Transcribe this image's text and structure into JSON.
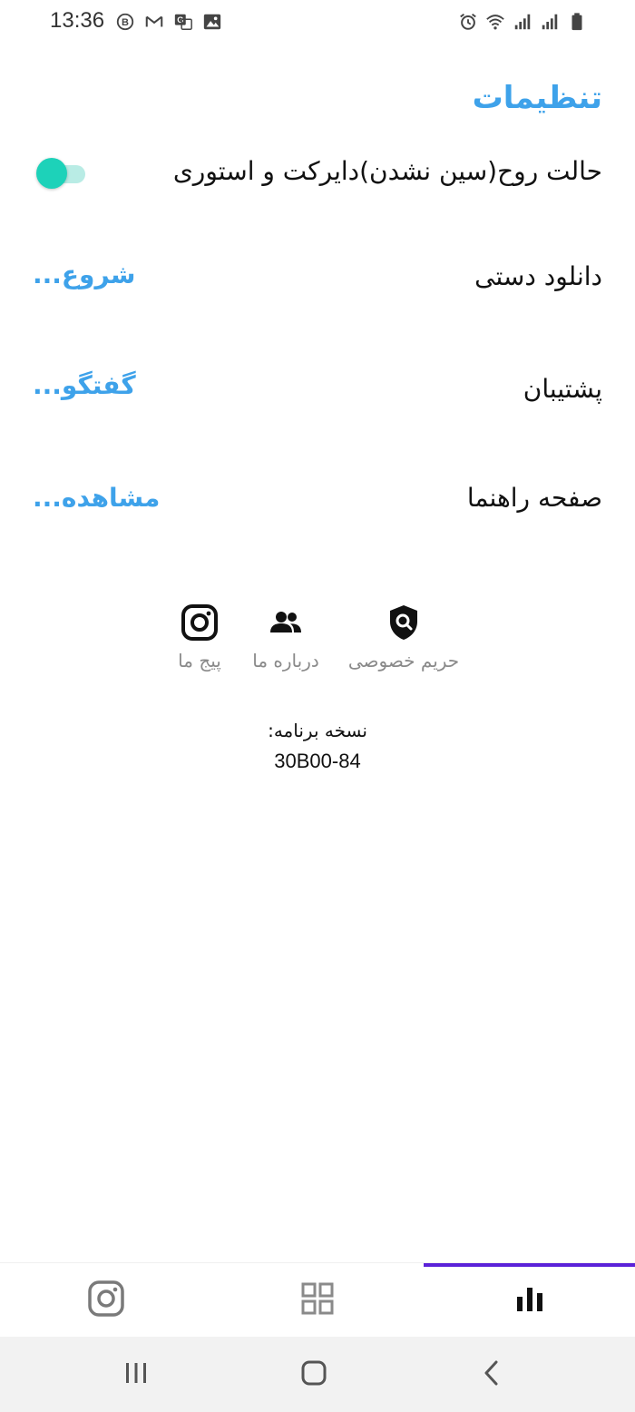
{
  "status_bar": {
    "time": "13:36",
    "left_icons": [
      "b-circle-icon",
      "gmail-icon",
      "translate-icon",
      "image-icon"
    ],
    "right_icons": [
      "alarm-icon",
      "wifi-icon",
      "signal-icon",
      "signal-icon",
      "battery-icon"
    ]
  },
  "page": {
    "title": "تنظیمات"
  },
  "settings": {
    "ghost_mode": {
      "label": "حالت روح(سین نشدن)دایرکت و استوری",
      "enabled": true
    },
    "manual_download": {
      "label": "دانلود دستی",
      "action": "شروع..."
    },
    "support": {
      "label": "پشتیبان",
      "action": "گفتگو..."
    },
    "guide": {
      "label": "صفحه راهنما",
      "action": "مشاهده..."
    }
  },
  "links": {
    "privacy": {
      "label": "حریم خصوصی",
      "icon": "shield-search-icon"
    },
    "about": {
      "label": "درباره ما",
      "icon": "people-icon"
    },
    "instagram": {
      "label": "پیج ما",
      "icon": "instagram-icon"
    }
  },
  "version": {
    "label": "نسخه برنامه:",
    "value": "30B00-84"
  },
  "bottom_tabs": {
    "active": "stats",
    "items": [
      "instagram-icon",
      "grid-icon",
      "bar-chart-icon"
    ]
  },
  "colors": {
    "accent": "#3ea2ea",
    "toggle_on": "#1dd2b9",
    "tab_indicator": "#5b21d8"
  }
}
